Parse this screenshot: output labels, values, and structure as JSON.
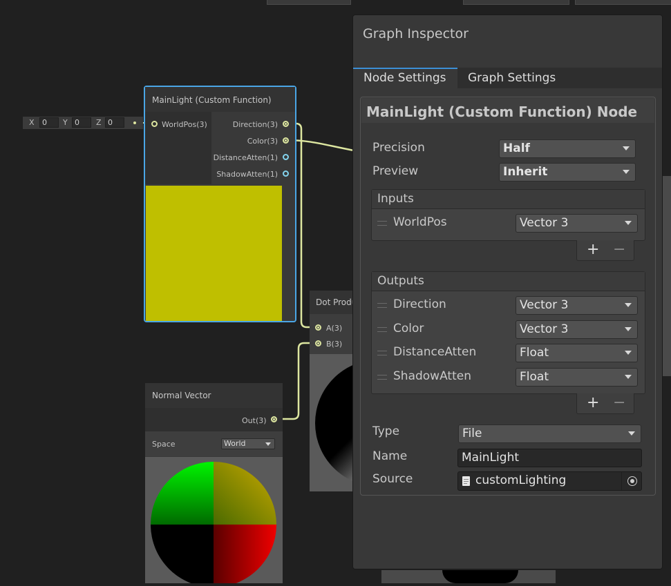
{
  "graph": {
    "vector_field": {
      "x_label": "X",
      "x_value": "0",
      "y_label": "Y",
      "y_value": "0",
      "z_label": "Z",
      "z_value": "0"
    },
    "mainlight_node": {
      "title": "MainLight (Custom Function)",
      "input": "WorldPos(3)",
      "outputs": [
        "Direction(3)",
        "Color(3)",
        "DistanceAtten(1)",
        "ShadowAtten(1)"
      ],
      "preview_color": "#bfbf00"
    },
    "dot_node": {
      "title": "Dot Produ",
      "inputs": [
        "A(3)",
        "B(3)"
      ]
    },
    "normal_node": {
      "title": "Normal Vector",
      "output": "Out(3)",
      "space_label": "Space",
      "space_value": "World"
    }
  },
  "inspector": {
    "title": "Graph Inspector",
    "tabs": [
      "Node Settings",
      "Graph Settings"
    ],
    "active_tab": "Node Settings",
    "node_header": "MainLight (Custom Function) Node",
    "precision": {
      "label": "Precision",
      "value": "Half"
    },
    "preview": {
      "label": "Preview",
      "value": "Inherit"
    },
    "inputs": {
      "title": "Inputs",
      "items": [
        {
          "name": "WorldPos",
          "type": "Vector 3"
        }
      ]
    },
    "outputs": {
      "title": "Outputs",
      "items": [
        {
          "name": "Direction",
          "type": "Vector 3"
        },
        {
          "name": "Color",
          "type": "Vector 3"
        },
        {
          "name": "DistanceAtten",
          "type": "Float"
        },
        {
          "name": "ShadowAtten",
          "type": "Float"
        }
      ]
    },
    "add_symbol": "+",
    "remove_symbol": "−",
    "type": {
      "label": "Type",
      "value": "File"
    },
    "name": {
      "label": "Name",
      "value": "MainLight"
    },
    "source": {
      "label": "Source",
      "value": "customLighting"
    }
  },
  "colors": {
    "selection": "#4aa6e6",
    "wire": "#dde6a0",
    "accent_tab": "#3c8fd6"
  }
}
